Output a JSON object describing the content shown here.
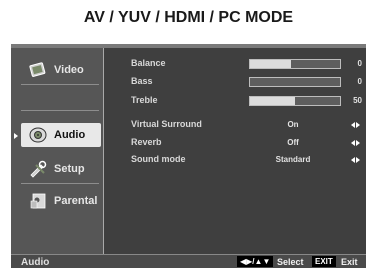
{
  "page": {
    "title": "AV / YUV / HDMI / PC MODE"
  },
  "sidebar": {
    "items": [
      {
        "label": "Video",
        "icon": "video-icon",
        "selected": false
      },
      {
        "label": "Audio",
        "icon": "audio-icon",
        "selected": true
      },
      {
        "label": "Setup",
        "icon": "setup-icon",
        "selected": false
      },
      {
        "label": "Parental",
        "icon": "parental-icon",
        "selected": false
      }
    ]
  },
  "audio_settings": {
    "balance": {
      "label": "Balance",
      "value": "0",
      "level": 0.5
    },
    "bass": {
      "label": "Bass",
      "value": "0",
      "level": 0.0
    },
    "treble": {
      "label": "Treble",
      "value": "50",
      "level": 0.5
    },
    "virtual_surround": {
      "label": "Virtual Surround",
      "value": "On"
    },
    "reverb": {
      "label": "Reverb",
      "value": "Off"
    },
    "sound_mode": {
      "label": "Sound mode",
      "value": "Standard"
    }
  },
  "footer": {
    "title": "Audio",
    "nav_keys": "◀▶/▲▼",
    "select_label": "Select",
    "exit_key": "EXIT",
    "exit_label": "Exit"
  },
  "colors": {
    "osd_background": "#3f3f3f",
    "sidebar_background": "#565656",
    "selected_background": "#e8e8e8",
    "slider_fill": "#dcdcdc"
  }
}
